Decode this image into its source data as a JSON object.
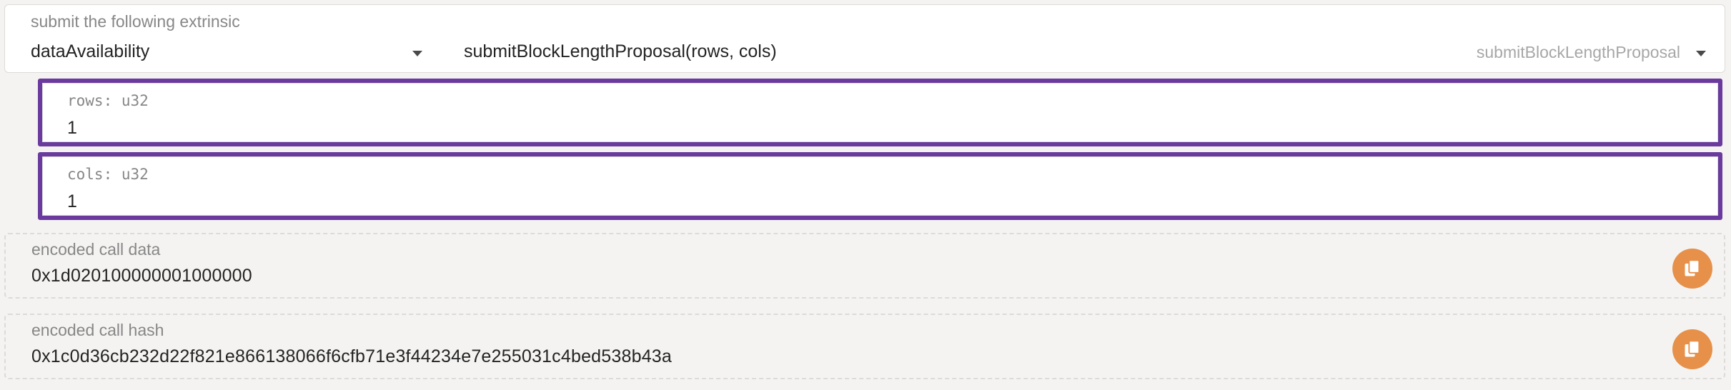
{
  "extrinsic": {
    "label": "submit the following extrinsic",
    "section": "dataAvailability",
    "method_signature": "submitBlockLengthProposal(rows, cols)",
    "method_name": "submitBlockLengthProposal"
  },
  "params": [
    {
      "label": "rows: u32",
      "value": "1"
    },
    {
      "label": "cols: u32",
      "value": "1"
    }
  ],
  "encoded_call_data": {
    "label": "encoded call data",
    "value": "0x1d020100000001000000",
    "icon": "copy-icon"
  },
  "encoded_call_hash": {
    "label": "encoded call hash",
    "value": "0x1c0d36cb232d22f821e866138066f6cfb71e3f44234e7e255031c4bed538b43a",
    "icon": "copy-icon"
  },
  "colors": {
    "focus_border": "#6a3a9e",
    "copy_button": "#e6904a",
    "page_background": "#f4f3f1"
  }
}
